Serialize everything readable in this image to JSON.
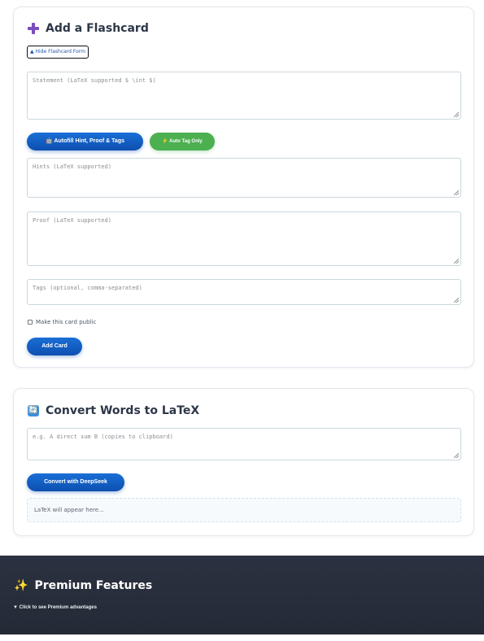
{
  "flashcard": {
    "title": "Add a Flashcard",
    "hide_button": "▲ Hide Flashcard Form",
    "statement_placeholder": "Statement (LaTeX supported $ \\int $)",
    "autofill_button": "🤖 Autofill Hint, Proof & Tags",
    "autotag_button": "⚡ Auto Tag Only",
    "hints_placeholder": "Hints (LaTeX supported)",
    "proof_placeholder": "Proof (LaTeX supported)",
    "tags_placeholder": "Tags (optional, comma-separated)",
    "public_label": "Make this card public",
    "add_button": "Add Card"
  },
  "convert": {
    "icon": "🔄",
    "title": "Convert Words to LaTeX",
    "input_placeholder": "e.g. A direct sum B (copies to clipboard)",
    "convert_button": "Convert with DeepSeek",
    "output_text": "LaTeX will appear here..."
  },
  "premium": {
    "icon": "✨",
    "title": "Premium Features",
    "toggle_text": "▼ Click to see Premium advantages"
  },
  "colors": {
    "accent_blue": "#0d4fb0",
    "accent_green": "#4caf50",
    "footer_bg": "#242a36"
  }
}
